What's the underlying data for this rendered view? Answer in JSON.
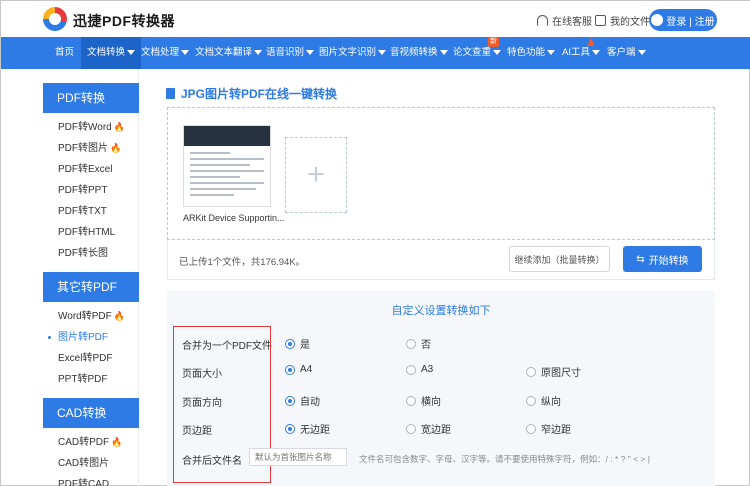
{
  "header": {
    "brand": "迅捷PDF转换器",
    "service_label": "在线客服",
    "files_label": "我的文件",
    "login_label": "登录 | 注册"
  },
  "nav": {
    "items": [
      {
        "label": "首页",
        "dropdown": false
      },
      {
        "label": "文档转换",
        "dropdown": true
      },
      {
        "label": "文档处理",
        "dropdown": true
      },
      {
        "label": "文档文本翻译",
        "dropdown": true
      },
      {
        "label": "语音识别",
        "dropdown": true
      },
      {
        "label": "图片文字识别",
        "dropdown": true
      },
      {
        "label": "音视频转换",
        "dropdown": true
      },
      {
        "label": "论文查重",
        "dropdown": true
      },
      {
        "label": "特色功能",
        "dropdown": true
      },
      {
        "label": "AI工具",
        "dropdown": true
      },
      {
        "label": "客户端",
        "dropdown": true
      }
    ],
    "new_badge": "新",
    "active_index": 1
  },
  "sidebar": {
    "sections": [
      {
        "title": "PDF转换",
        "items": [
          {
            "label": "PDF转Word",
            "hot": true
          },
          {
            "label": "PDF转图片",
            "hot": true
          },
          {
            "label": "PDF转Excel",
            "hot": false
          },
          {
            "label": "PDF转PPT",
            "hot": false
          },
          {
            "label": "PDF转TXT",
            "hot": false
          },
          {
            "label": "PDF转HTML",
            "hot": false
          },
          {
            "label": "PDF转长图",
            "hot": false
          }
        ]
      },
      {
        "title": "其它转PDF",
        "items": [
          {
            "label": "Word转PDF",
            "hot": true
          },
          {
            "label": "图片转PDF",
            "hot": false,
            "selected": true
          },
          {
            "label": "Excel转PDF",
            "hot": false
          },
          {
            "label": "PPT转PDF",
            "hot": false
          }
        ]
      },
      {
        "title": "CAD转换",
        "items": [
          {
            "label": "CAD转PDF",
            "hot": true
          },
          {
            "label": "CAD转图片",
            "hot": false
          },
          {
            "label": "PDF转CAD",
            "hot": false
          }
        ]
      }
    ]
  },
  "main": {
    "title": "JPG图片转PDF在线一键转换",
    "file_name": "ARKit Device Supportin...",
    "thumb_heading": "Verifying Device Support and User Permission",
    "status_text": "已上传1个文件，共176.94K。",
    "add_button": "继续添加（批量转换）",
    "start_button": "开始转换"
  },
  "settings": {
    "title": "自定义设置转换如下",
    "rows": [
      {
        "label": "合并为一个PDF文件",
        "options": [
          {
            "label": "是",
            "checked": true
          },
          {
            "label": "否",
            "checked": false
          }
        ]
      },
      {
        "label": "页面大小",
        "options": [
          {
            "label": "A4",
            "checked": true
          },
          {
            "label": "A3",
            "checked": false
          },
          {
            "label": "原图尺寸",
            "checked": false
          }
        ]
      },
      {
        "label": "页面方向",
        "options": [
          {
            "label": "自动",
            "checked": true
          },
          {
            "label": "横向",
            "checked": false
          },
          {
            "label": "纵向",
            "checked": false
          }
        ]
      },
      {
        "label": "页边距",
        "options": [
          {
            "label": "无边距",
            "checked": true
          },
          {
            "label": "宽边距",
            "checked": false
          },
          {
            "label": "窄边距",
            "checked": false
          }
        ]
      }
    ],
    "filename_label": "合并后文件名",
    "filename_placeholder": "默认为首张图片名称",
    "filename_hint": "文件名可包含数字、字母、汉字等。请不要使用特殊字符，例如：/ : * ? \" < > |"
  },
  "colors": {
    "accent": "#2e7be6",
    "highlight": "#e23b3b",
    "hot": "#f25c2a"
  }
}
